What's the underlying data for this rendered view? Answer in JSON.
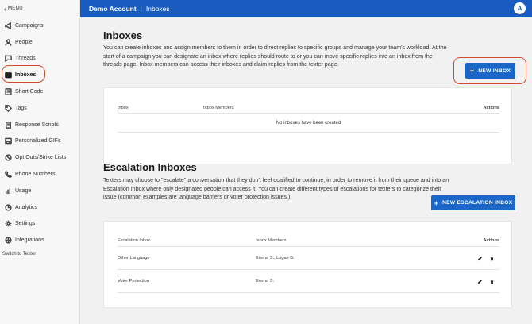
{
  "sidebar": {
    "menu_label": "MENU",
    "items": [
      {
        "label": "Campaigns",
        "icon": "megaphone-icon"
      },
      {
        "label": "People",
        "icon": "person-icon"
      },
      {
        "label": "Threads",
        "icon": "chat-icon"
      },
      {
        "label": "Inboxes",
        "icon": "inbox-icon",
        "active": true
      },
      {
        "label": "Short Code",
        "icon": "short-code-icon"
      },
      {
        "label": "Tags",
        "icon": "tag-icon"
      },
      {
        "label": "Response Scripts",
        "icon": "script-icon"
      },
      {
        "label": "Personalized GIFs",
        "icon": "gif-icon"
      },
      {
        "label": "Opt Outs/Strike Lists",
        "icon": "block-icon"
      },
      {
        "label": "Phone Numbers",
        "icon": "phone-icon"
      },
      {
        "label": "Usage",
        "icon": "bar-chart-icon"
      },
      {
        "label": "Analytics",
        "icon": "analytics-icon"
      },
      {
        "label": "Settings",
        "icon": "gear-icon"
      },
      {
        "label": "Integrations",
        "icon": "integrations-icon"
      }
    ],
    "switch_label": "Switch to Texter"
  },
  "topbar": {
    "account": "Demo Account",
    "separator": "|",
    "page": "Inboxes",
    "avatar_initial": "A"
  },
  "inboxes": {
    "title": "Inboxes",
    "description": "You can create inboxes and assign members to them in order to direct replies to specific groups and manage your team's workload. At the start of a campaign you can designate an inbox where replies should route to or you can move specific replies into an inbox from the threads page. Inbox members can access their inboxes and claim replies from the texter page.",
    "button_label": "NEW INBOX",
    "table": {
      "col_inbox": "Inbox",
      "col_members": "Inbox Members",
      "col_actions": "Actions",
      "empty_message": "No inboxes have been created"
    }
  },
  "escalation": {
    "title": "Escalation Inboxes",
    "description": "Texters may choose to \"escalate\" a conversation that they don't feel qualified to continue, in order to remove it from their queue and into an Escalation Inbox where only designated people can access it. You can create different types of escalations for texters to categorize their issue (common examples are language barriers or voter protection issues.)",
    "button_label": "NEW ESCALATION INBOX",
    "table": {
      "col_inbox": "Escalation Inbox",
      "col_members": "Inbox Members",
      "col_actions": "Actions",
      "rows": [
        {
          "inbox": "Other Language",
          "members": "Emma S., Logan B."
        },
        {
          "inbox": "Voter Protection",
          "members": "Emma S."
        }
      ]
    }
  },
  "colors": {
    "brand_blue": "#1a5bbf",
    "button_blue": "#1a66c9",
    "highlight_ring": "#d14b2e"
  }
}
